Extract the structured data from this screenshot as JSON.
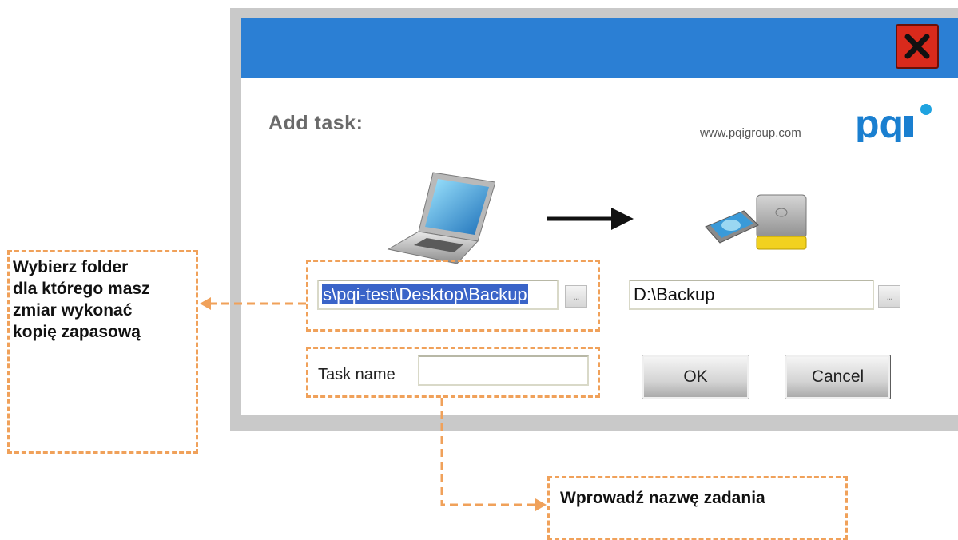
{
  "dialog": {
    "title_text": "Add task:",
    "website": "www.pqigroup.com",
    "logo_text": "pqi",
    "source_path": "s\\pqi-test\\Desktop\\Backup",
    "destination_path": "D:\\Backup",
    "browse_label": "...",
    "task_name_label": "Task name",
    "task_name_value": "",
    "ok_label": "OK",
    "cancel_label": "Cancel"
  },
  "annotations": {
    "folder_note_lines": [
      "Wybierz folder",
      "dla którego masz",
      "zmiar wykonać",
      "kopię zapasową"
    ],
    "task_note": "Wprowadź nazwę zadania"
  },
  "colors": {
    "titlebar": "#2b7fd4",
    "close": "#d92a1c",
    "selection": "#3a64c8",
    "annotation": "#f0a15a",
    "logo": "#1a7fd0"
  },
  "icons": [
    "close-icon",
    "laptop-icon",
    "arrow-right-icon",
    "external-drive-icon"
  ]
}
